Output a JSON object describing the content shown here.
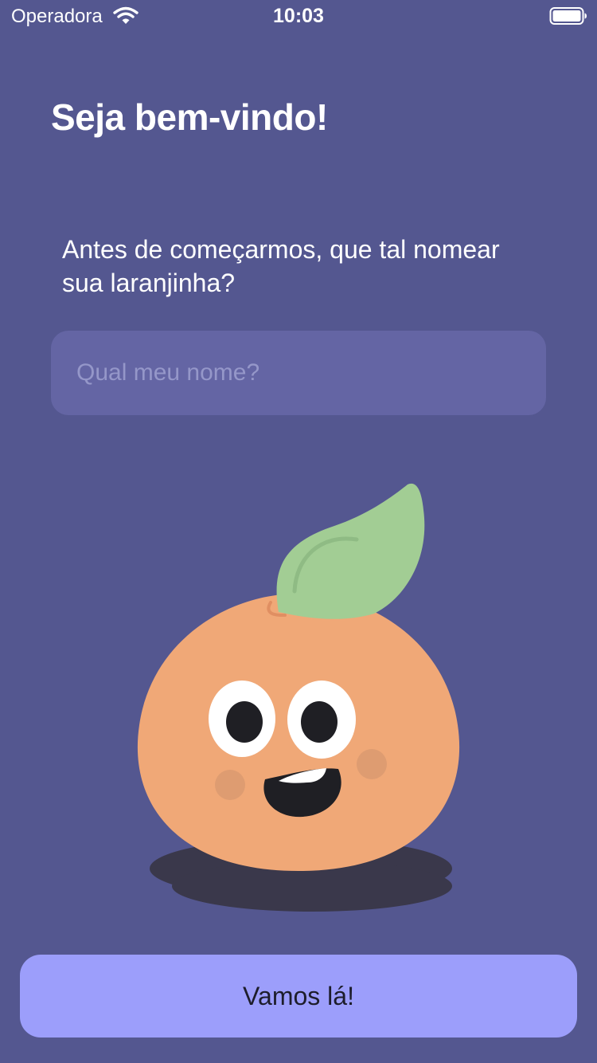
{
  "status_bar": {
    "carrier": "Operadora",
    "time": "10:03",
    "icons": [
      "wifi-icon",
      "battery-icon"
    ]
  },
  "onboarding": {
    "title": "Seja bem-vindo!",
    "prompt": "Antes de começarmos, que tal nomear sua laranjinha?",
    "name_input": {
      "value": "",
      "placeholder": "Qual meu nome?"
    },
    "mascot": "orange-mascot",
    "cta_label": "Vamos lá!"
  },
  "colors": {
    "background": "#545790",
    "input_background": "#6465a4",
    "input_placeholder": "#9597c9",
    "button_background": "#9c9efb",
    "button_text": "#1d1d2b",
    "orange_body": "#f0a877",
    "leaf": "#a2cd94",
    "shadow": "#3a384b"
  }
}
